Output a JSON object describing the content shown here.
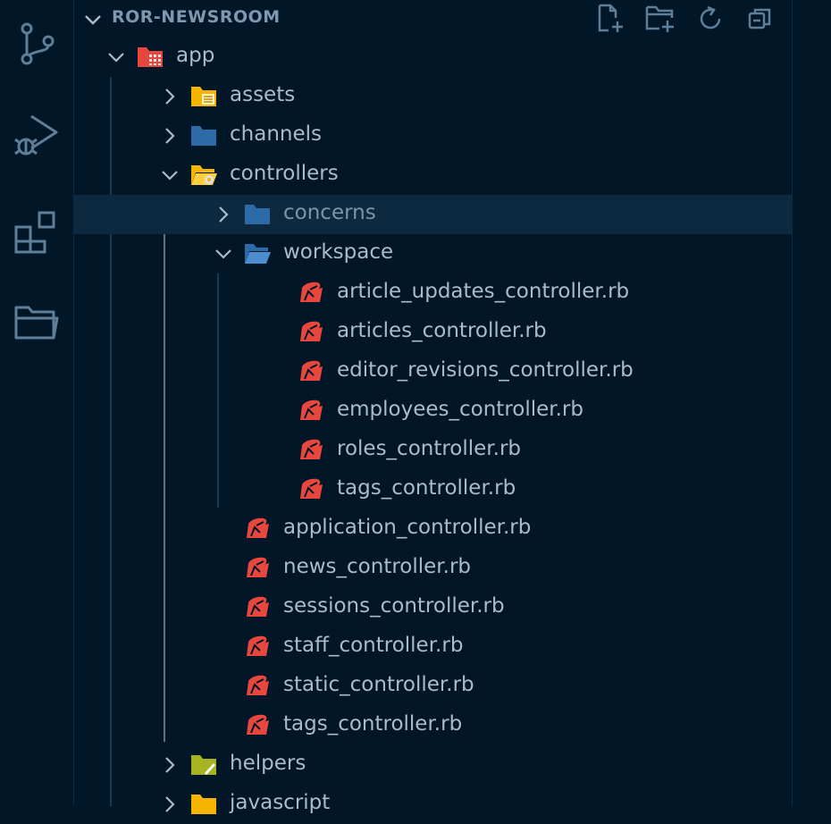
{
  "colors": {
    "background": "#011627",
    "selected_row": "#0c2940",
    "text": "#a9bccd",
    "icon_gray": "#5f7e97",
    "folder_blue": "#2d6aa8",
    "folder_yellow": "#f4b400",
    "folder_green": "#a8b322",
    "ruby_red": "#e8473d"
  },
  "activity_bar": {
    "items": [
      {
        "name": "source-control-icon"
      },
      {
        "name": "run-debug-icon"
      },
      {
        "name": "extensions-icon"
      },
      {
        "name": "explorer-icon"
      }
    ]
  },
  "explorer": {
    "title": "ROR-NEWSROOM",
    "actions": [
      "new-file-icon",
      "new-folder-icon",
      "refresh-icon",
      "collapse-all-icon"
    ]
  },
  "tree": [
    {
      "label": "app",
      "depth": 0,
      "type": "folder",
      "expanded": true,
      "icon": "rails-folder-icon"
    },
    {
      "label": "assets",
      "depth": 1,
      "type": "folder",
      "expanded": false,
      "icon": "assets-folder-icon"
    },
    {
      "label": "channels",
      "depth": 1,
      "type": "folder",
      "expanded": false,
      "icon": "folder-icon"
    },
    {
      "label": "controllers",
      "depth": 1,
      "type": "folder",
      "expanded": true,
      "icon": "controllers-folder-icon"
    },
    {
      "label": "concerns",
      "depth": 2,
      "type": "folder",
      "expanded": false,
      "icon": "folder-icon",
      "selected": true
    },
    {
      "label": "workspace",
      "depth": 2,
      "type": "folder",
      "expanded": true,
      "icon": "folder-open-icon"
    },
    {
      "label": "article_updates_controller.rb",
      "depth": 3,
      "type": "file",
      "icon": "ruby-file-icon"
    },
    {
      "label": "articles_controller.rb",
      "depth": 3,
      "type": "file",
      "icon": "ruby-file-icon"
    },
    {
      "label": "editor_revisions_controller.rb",
      "depth": 3,
      "type": "file",
      "icon": "ruby-file-icon"
    },
    {
      "label": "employees_controller.rb",
      "depth": 3,
      "type": "file",
      "icon": "ruby-file-icon"
    },
    {
      "label": "roles_controller.rb",
      "depth": 3,
      "type": "file",
      "icon": "ruby-file-icon"
    },
    {
      "label": "tags_controller.rb",
      "depth": 3,
      "type": "file",
      "icon": "ruby-file-icon"
    },
    {
      "label": "application_controller.rb",
      "depth": 2,
      "type": "file",
      "icon": "ruby-file-icon"
    },
    {
      "label": "news_controller.rb",
      "depth": 2,
      "type": "file",
      "icon": "ruby-file-icon"
    },
    {
      "label": "sessions_controller.rb",
      "depth": 2,
      "type": "file",
      "icon": "ruby-file-icon"
    },
    {
      "label": "staff_controller.rb",
      "depth": 2,
      "type": "file",
      "icon": "ruby-file-icon"
    },
    {
      "label": "static_controller.rb",
      "depth": 2,
      "type": "file",
      "icon": "ruby-file-icon"
    },
    {
      "label": "tags_controller.rb",
      "depth": 2,
      "type": "file",
      "icon": "ruby-file-icon"
    },
    {
      "label": "helpers",
      "depth": 1,
      "type": "folder",
      "expanded": false,
      "icon": "helpers-folder-icon"
    },
    {
      "label": "javascript",
      "depth": 1,
      "type": "folder",
      "expanded": false,
      "icon": "js-folder-icon"
    }
  ]
}
